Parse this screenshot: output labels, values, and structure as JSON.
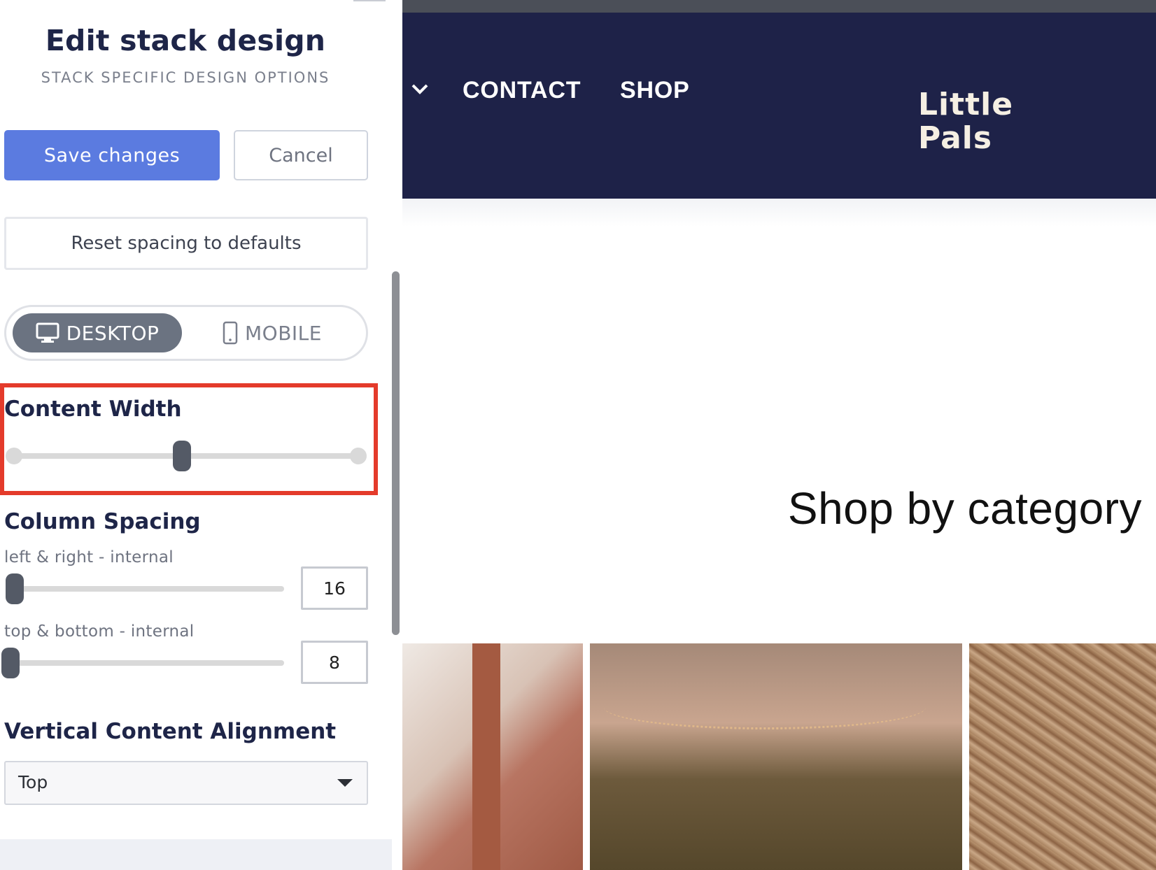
{
  "panel": {
    "title": "Edit stack design",
    "subtitle": "STACK SPECIFIC DESIGN OPTIONS",
    "save_label": "Save changes",
    "cancel_label": "Cancel",
    "reset_label": "Reset spacing to defaults",
    "device_toggle": {
      "desktop_label": "DESKTOP",
      "mobile_label": "MOBILE",
      "selected": "DESKTOP"
    },
    "content_width": {
      "label": "Content Width",
      "slider_fraction": 0.5
    },
    "column_spacing": {
      "label": "Column Spacing",
      "left_right": {
        "label": "left & right - internal",
        "value": "16"
      },
      "top_bottom": {
        "label": "top & bottom - internal",
        "value": "8"
      }
    },
    "vertical_alignment": {
      "label": "Vertical Content Alignment",
      "selected": "Top"
    }
  },
  "preview": {
    "nav": {
      "partial_item_chevron": "∨",
      "contact": "CONTACT",
      "shop": "SHOP"
    },
    "logo": {
      "line1": "Little",
      "line2": "Pals"
    },
    "section_heading": "Shop by category"
  },
  "colors": {
    "accent": "#5b7be0",
    "header_bg": "#1e2248",
    "highlight": "#e43b2b",
    "heading_text": "#1e2548"
  }
}
